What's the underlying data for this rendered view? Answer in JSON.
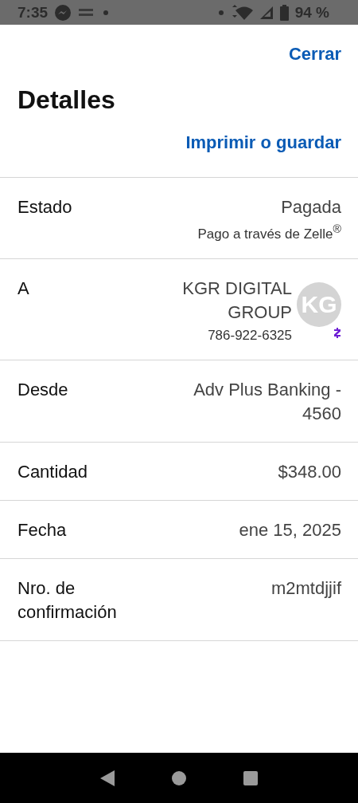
{
  "status_bar": {
    "time": "7:35",
    "battery": "94 %"
  },
  "header": {
    "close": "Cerrar",
    "title": "Detalles",
    "print": "Imprimir o guardar"
  },
  "rows": [
    {
      "kind": "payment",
      "label": "Estado",
      "value": "Pagada",
      "note": "Pago a través de Zelle$^{®}$"
    },
    {
      "kind": "recipient",
      "label": "A",
      "value": "KGR DIGITAL GROUP",
      "note": "786-922-6325",
      "initials": "KG"
    },
    {
      "kind": "plain",
      "label": "Desde",
      "value": "Adv Plus Banking - 4560"
    },
    {
      "kind": "plain",
      "label": "Cantidad",
      "value": "$348.00"
    },
    {
      "kind": "plain",
      "label": "Fecha",
      "value": "ene 15, 2025"
    },
    {
      "kind": "plain",
      "label": "Nro. de confirmación",
      "value": "m2mtdjjif"
    }
  ]
}
